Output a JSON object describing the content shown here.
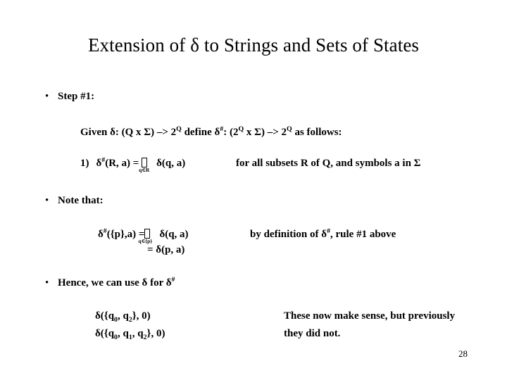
{
  "slide": {
    "title": "Extension of δ to Strings and Sets of States",
    "page_number": "28",
    "background_color": "#ffffff",
    "text_color": "#000000"
  },
  "bullets": [
    {
      "marker": "•",
      "label": "Step #1:"
    },
    {
      "marker": "•",
      "label": "Note that:"
    },
    {
      "marker": "•",
      "label": "Hence, we can use δ for δ#"
    }
  ],
  "step1": {
    "given_line": {
      "prefix": "Given δ: (Q x Σ) –> 2",
      "sup1": "Q",
      "middle": " define δ",
      "sup_hash": "#",
      "after_hash": ": (2",
      "sup2": "Q",
      "middle2": " x Σ) –> 2",
      "sup3": "Q",
      "suffix": " as follows:"
    },
    "rule1": {
      "number": "1)",
      "lhs": "δ",
      "lhs_sup": "#",
      "lhs_args": "(R, a) = ",
      "bigop_limit": "q∈R",
      "rhs": "δ(q, a)",
      "condition": "for all subsets R of Q, and symbols a in Σ"
    }
  },
  "note": {
    "line1": {
      "lhs": "δ",
      "lhs_sup": "#",
      "lhs_args": "({p},a) =",
      "bigop_limit": "q∈{p}",
      "rhs": "δ(q, a)",
      "comment_prefix": "by definition of δ",
      "comment_sup": "#",
      "comment_suffix": ", rule #1 above"
    },
    "line2": "= δ(p, a)"
  },
  "hence": {
    "expr1_prefix": "δ({q",
    "expr1_sub1": "0",
    "expr1_mid": ", q",
    "expr1_sub2": "2",
    "expr1_suffix": "}, 0)",
    "expr2_prefix": "δ({q",
    "expr2_sub1": "0",
    "expr2_mid1": ", q",
    "expr2_sub2": "1",
    "expr2_mid2": ", q",
    "expr2_sub3": "2",
    "expr2_suffix": "}, 0)",
    "comment_line1": "These now make sense, but previously",
    "comment_line2": "they did not."
  }
}
